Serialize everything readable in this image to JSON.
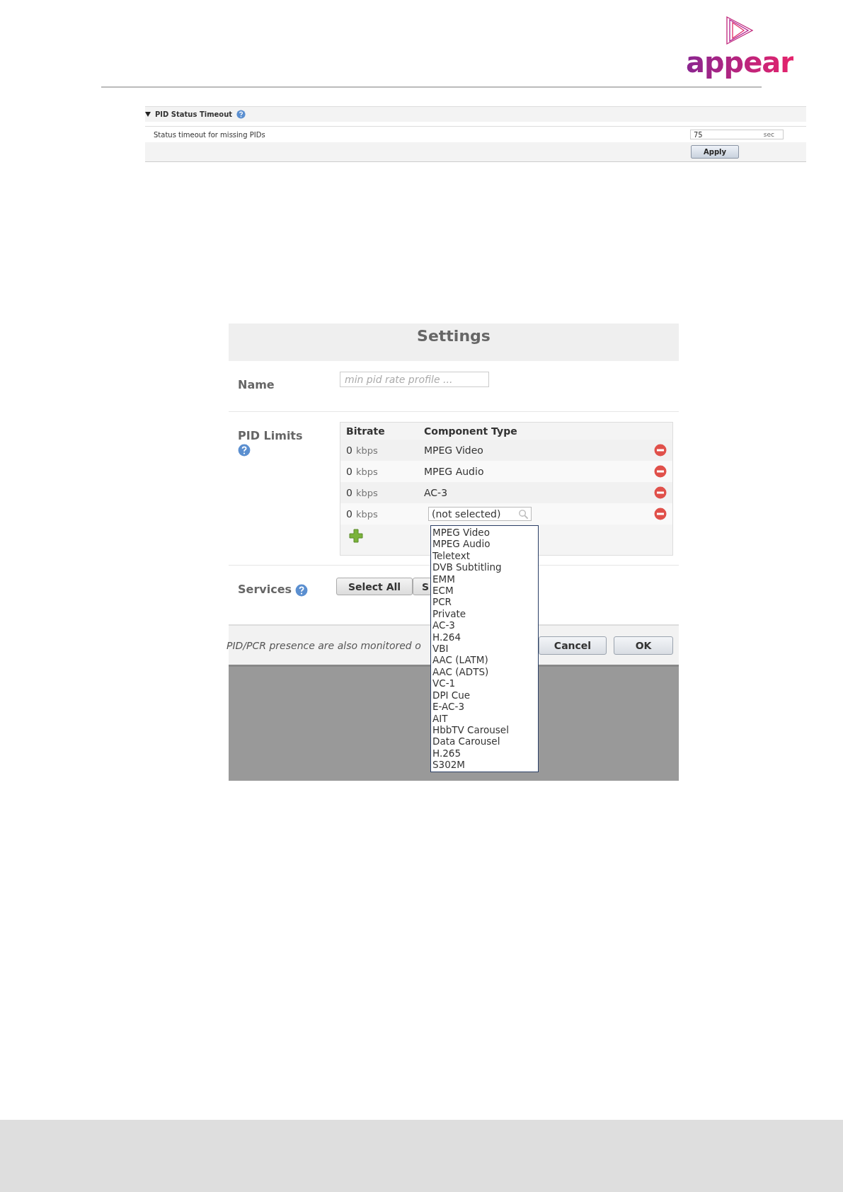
{
  "logo": {
    "text": "appear"
  },
  "pid_status_timeout": {
    "title": "PID Status Timeout",
    "expanded": true,
    "label": "Status timeout for missing PIDs",
    "value": "75",
    "unit": "sec",
    "button": "Apply"
  },
  "dialog": {
    "title": "Settings",
    "name": {
      "label": "Name",
      "placeholder": "min pid rate profile ..."
    },
    "pid_limits": {
      "label": "PID Limits",
      "columns": [
        "Bitrate",
        "Component Type"
      ],
      "rows": [
        {
          "kind": "text",
          "bitrate": "0",
          "unit": "kbps",
          "component": "MPEG Video"
        },
        {
          "kind": "text",
          "bitrate": "0",
          "unit": "kbps",
          "component": "MPEG Audio"
        },
        {
          "kind": "text",
          "bitrate": "0",
          "unit": "kbps",
          "component": "AC-3"
        },
        {
          "kind": "select",
          "bitrate": "0",
          "unit": "kbps",
          "component": "(not selected)"
        }
      ]
    },
    "services": {
      "label": "Services",
      "buttons": [
        "Select All",
        "S"
      ]
    },
    "footer": {
      "note": "PID/PCR presence are also monitored o",
      "buttons": [
        "Cancel",
        "OK"
      ]
    },
    "dropdown": {
      "options": [
        "MPEG Video",
        "MPEG Audio",
        "Teletext",
        "DVB Subtitling",
        "EMM",
        "ECM",
        "PCR",
        "Private",
        "AC-3",
        "H.264",
        "VBI",
        "AAC (LATM)",
        "AAC (ADTS)",
        "VC-1",
        "DPI Cue",
        "E-AC-3",
        "AIT",
        "HbbTV Carousel",
        "Data Carousel",
        "H.265",
        "S302M"
      ]
    }
  }
}
